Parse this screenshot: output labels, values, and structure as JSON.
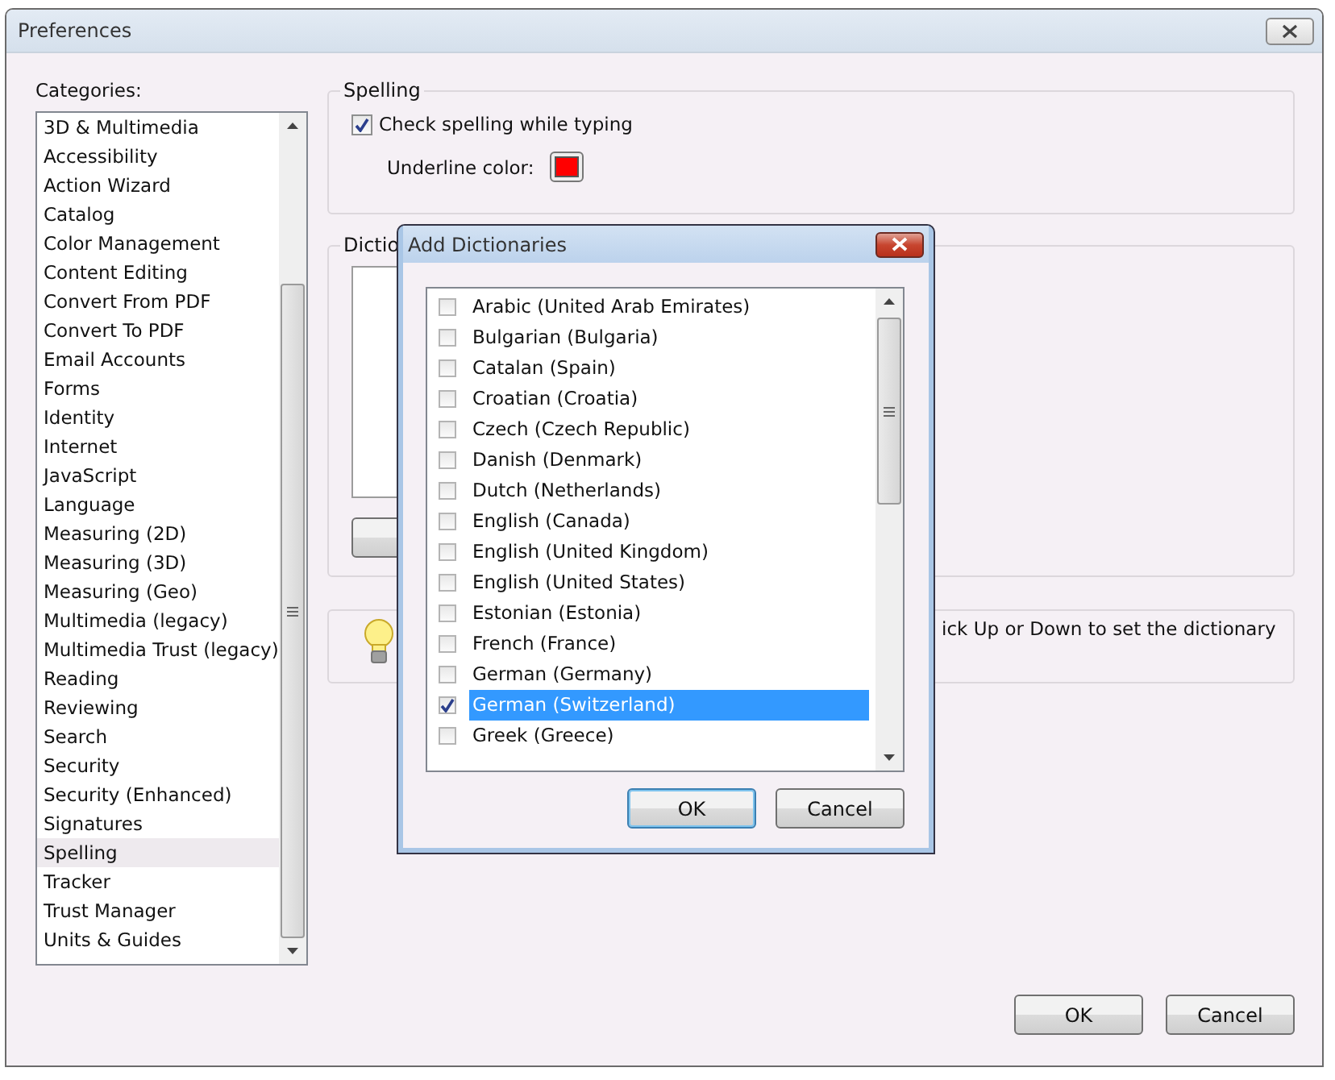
{
  "window": {
    "title": "Preferences"
  },
  "categories": {
    "label": "Categories:",
    "items": [
      {
        "label": "3D & Multimedia",
        "selected": false
      },
      {
        "label": "Accessibility",
        "selected": false
      },
      {
        "label": "Action Wizard",
        "selected": false
      },
      {
        "label": "Catalog",
        "selected": false
      },
      {
        "label": "Color Management",
        "selected": false
      },
      {
        "label": "Content Editing",
        "selected": false
      },
      {
        "label": "Convert From PDF",
        "selected": false
      },
      {
        "label": "Convert To PDF",
        "selected": false
      },
      {
        "label": "Email Accounts",
        "selected": false
      },
      {
        "label": "Forms",
        "selected": false
      },
      {
        "label": "Identity",
        "selected": false
      },
      {
        "label": "Internet",
        "selected": false
      },
      {
        "label": "JavaScript",
        "selected": false
      },
      {
        "label": "Language",
        "selected": false
      },
      {
        "label": "Measuring (2D)",
        "selected": false
      },
      {
        "label": "Measuring (3D)",
        "selected": false
      },
      {
        "label": "Measuring (Geo)",
        "selected": false
      },
      {
        "label": "Multimedia (legacy)",
        "selected": false
      },
      {
        "label": "Multimedia Trust (legacy)",
        "selected": false
      },
      {
        "label": "Reading",
        "selected": false
      },
      {
        "label": "Reviewing",
        "selected": false
      },
      {
        "label": "Search",
        "selected": false
      },
      {
        "label": "Security",
        "selected": false
      },
      {
        "label": "Security (Enhanced)",
        "selected": false
      },
      {
        "label": "Signatures",
        "selected": false
      },
      {
        "label": "Spelling",
        "selected": true
      },
      {
        "label": "Tracker",
        "selected": false
      },
      {
        "label": "Trust Manager",
        "selected": false
      },
      {
        "label": "Units & Guides",
        "selected": false
      }
    ]
  },
  "spelling": {
    "legend": "Spelling",
    "check_while_typing": {
      "label": "Check spelling while typing",
      "checked": true
    },
    "underline_color": {
      "label": "Underline color:",
      "color": "#ff0000"
    }
  },
  "dictionaries": {
    "legend": "Dictio"
  },
  "hint": {
    "text": "ick Up or Down to set the dictionary"
  },
  "buttons": [
    "OK",
    "Cancel"
  ],
  "dialog": {
    "title": "Add Dictionaries",
    "items": [
      {
        "label": "Arabic (United Arab Emirates)",
        "checked": false,
        "selected": false
      },
      {
        "label": "Bulgarian (Bulgaria)",
        "checked": false,
        "selected": false
      },
      {
        "label": "Catalan (Spain)",
        "checked": false,
        "selected": false
      },
      {
        "label": "Croatian (Croatia)",
        "checked": false,
        "selected": false
      },
      {
        "label": "Czech (Czech Republic)",
        "checked": false,
        "selected": false
      },
      {
        "label": "Danish (Denmark)",
        "checked": false,
        "selected": false
      },
      {
        "label": "Dutch (Netherlands)",
        "checked": false,
        "selected": false
      },
      {
        "label": "English (Canada)",
        "checked": false,
        "selected": false
      },
      {
        "label": "English (United Kingdom)",
        "checked": false,
        "selected": false
      },
      {
        "label": "English (United States)",
        "checked": false,
        "selected": false
      },
      {
        "label": "Estonian (Estonia)",
        "checked": false,
        "selected": false
      },
      {
        "label": "French (France)",
        "checked": false,
        "selected": false
      },
      {
        "label": "German (Germany)",
        "checked": false,
        "selected": false
      },
      {
        "label": "German (Switzerland)",
        "checked": true,
        "selected": true
      },
      {
        "label": "Greek (Greece)",
        "checked": false,
        "selected": false
      }
    ],
    "buttons": [
      {
        "label": "OK",
        "default": true
      },
      {
        "label": "Cancel",
        "default": false
      }
    ]
  }
}
